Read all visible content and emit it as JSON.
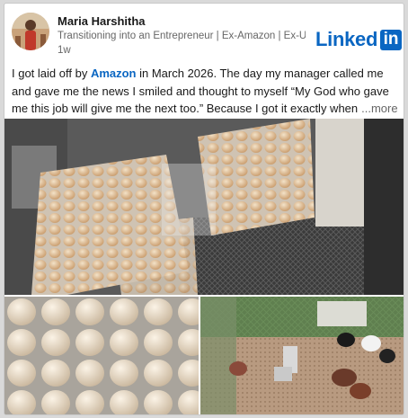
{
  "author": {
    "name": "Maria Harshitha",
    "headline": "Transitioning into an Entrepreneur | Ex-Amazon | Ex-Ub...",
    "time": "1w"
  },
  "brand": {
    "word": "Linked",
    "box": "in",
    "color": "#0a66c2"
  },
  "post": {
    "line1_a": "I got laid off by ",
    "mention": "Amazon",
    "line1_b": "  in March 2026. The day my manager called me",
    "line2": "and gave me the news I smiled and thought to myself “My God who gave",
    "line3": "me this job will give me the next too.” Because I got it exactly when",
    "see_more": "...more"
  },
  "photos": [
    {
      "icon": "egg-trays-photo"
    },
    {
      "icon": "egg-tray-closeup-photo"
    },
    {
      "icon": "chicken-coop-photo"
    }
  ]
}
